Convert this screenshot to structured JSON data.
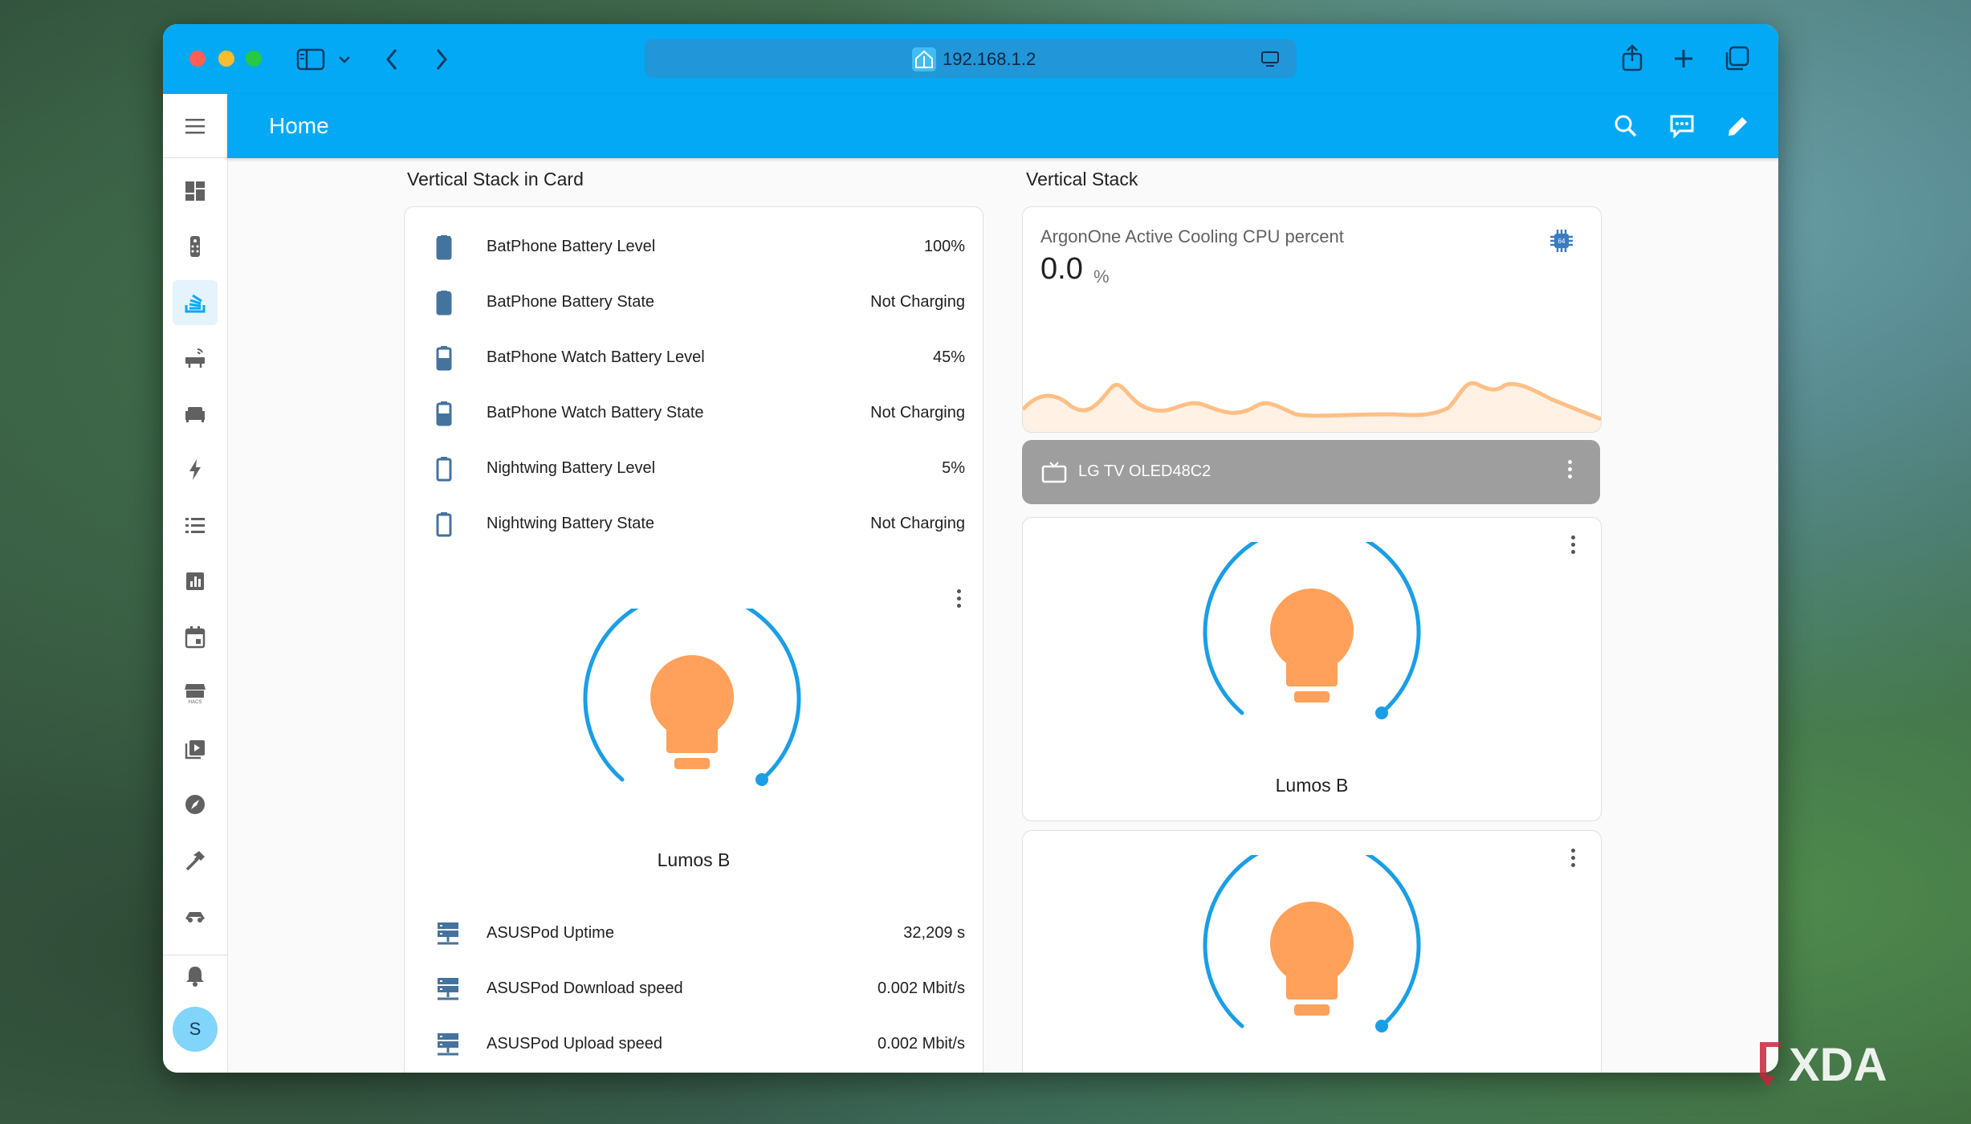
{
  "browser": {
    "url": "192.168.1.2",
    "traffic_colors": {
      "close": "#ff5f57",
      "minimize": "#febc2e",
      "maximize": "#28c840"
    }
  },
  "app": {
    "title": "Home",
    "accent": "#03a9f4",
    "avatar_initial": "S",
    "sidebar_icons": [
      "dashboard-icon",
      "remote-icon",
      "stack-icon",
      "router-icon",
      "sofa-icon",
      "lightning-icon",
      "list-icon",
      "chart-icon",
      "calendar-icon",
      "hacs-icon",
      "media-icon",
      "map-icon",
      "hammer-icon",
      "robot-icon",
      "bell-icon"
    ]
  },
  "left_column": {
    "title": "Vertical Stack in Card",
    "battery_entities": [
      {
        "name": "BatPhone Battery Level",
        "value": "100%"
      },
      {
        "name": "BatPhone Battery State",
        "value": "Not Charging"
      },
      {
        "name": "BatPhone Watch Battery Level",
        "value": "45%"
      },
      {
        "name": "BatPhone Watch Battery State",
        "value": "Not Charging"
      },
      {
        "name": "Nightwing Battery Level",
        "value": "5%"
      },
      {
        "name": "Nightwing Battery State",
        "value": "Not Charging"
      }
    ],
    "light": {
      "name": "Lumos B"
    },
    "router_entities": [
      {
        "name": "ASUSPod Uptime",
        "value": "32,209 s"
      },
      {
        "name": "ASUSPod Download speed",
        "value": "0.002 Mbit/s"
      },
      {
        "name": "ASUSPod Upload speed",
        "value": "0.002 Mbit/s"
      }
    ]
  },
  "right_column": {
    "title": "Vertical Stack",
    "sensor": {
      "name": "ArgonOne Active Cooling CPU percent",
      "value": "0.0",
      "unit": "%"
    },
    "tv": {
      "name": "LG TV OLED48C2"
    },
    "light1": {
      "name": "Lumos B"
    },
    "light_color": "#ffa15a",
    "ring_color": "#1a9ee6"
  }
}
